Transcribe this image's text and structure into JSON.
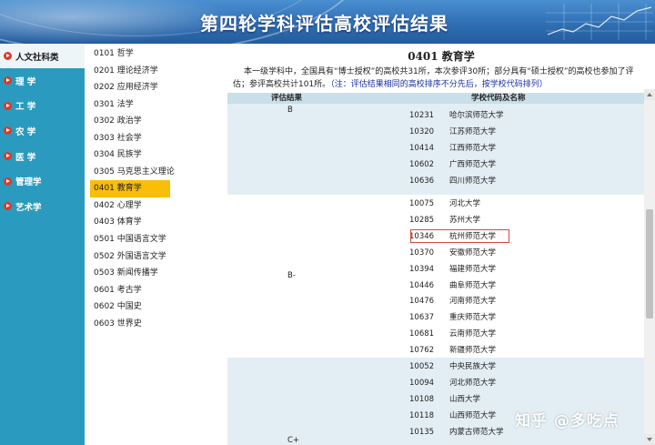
{
  "banner": {
    "title": "第四轮学科评估高校评估结果"
  },
  "left_nav": {
    "items": [
      {
        "label": "人文社科类",
        "active": true
      },
      {
        "label": "理 学",
        "active": false
      },
      {
        "label": "工 学",
        "active": false
      },
      {
        "label": "农 学",
        "active": false
      },
      {
        "label": "医 学",
        "active": false
      },
      {
        "label": "管理学",
        "active": false
      },
      {
        "label": "艺术学",
        "active": false
      }
    ]
  },
  "disciplines": [
    {
      "label": "0101 哲学",
      "selected": false
    },
    {
      "label": "0201 理论经济学",
      "selected": false
    },
    {
      "label": "0202 应用经济学",
      "selected": false
    },
    {
      "label": "0301 法学",
      "selected": false
    },
    {
      "label": "0302 政治学",
      "selected": false
    },
    {
      "label": "0303 社会学",
      "selected": false
    },
    {
      "label": "0304 民族学",
      "selected": false
    },
    {
      "label": "0305 马克思主义理论",
      "selected": false
    },
    {
      "label": "0401 教育学",
      "selected": true
    },
    {
      "label": "0402 心理学",
      "selected": false
    },
    {
      "label": "0403 体育学",
      "selected": false
    },
    {
      "label": "0501 中国语言文学",
      "selected": false
    },
    {
      "label": "0502 外国语言文学",
      "selected": false
    },
    {
      "label": "0503 新闻传播学",
      "selected": false
    },
    {
      "label": "0601 考古学",
      "selected": false
    },
    {
      "label": "0602 中国史",
      "selected": false
    },
    {
      "label": "0603 世界史",
      "selected": false
    }
  ],
  "content": {
    "title": "0401 教育学",
    "description": "本一级学科中，全国具有“博士授权”的高校共31所，本次参评30所；部分具有“硕士授权”的高校也参加了评估；参评高校共计101所。",
    "note": "（注：评估结果相同的高校排序不分先后，按学校代码排列）",
    "table_headers": {
      "grade": "评估结果",
      "school": "学校代码及名称"
    },
    "groups": [
      {
        "grade": "B",
        "rows": [
          {
            "code": "10231",
            "name": "哈尔滨师范大学"
          },
          {
            "code": "10320",
            "name": "江苏师范大学"
          },
          {
            "code": "10414",
            "name": "江西师范大学"
          },
          {
            "code": "10602",
            "name": "广西师范大学"
          },
          {
            "code": "10636",
            "name": "四川师范大学"
          }
        ]
      },
      {
        "grade": "B-",
        "rows": [
          {
            "code": "10075",
            "name": "河北大学"
          },
          {
            "code": "10285",
            "name": "苏州大学"
          },
          {
            "code": "10346",
            "name": "杭州师范大学",
            "highlighted": true
          },
          {
            "code": "10370",
            "name": "安徽师范大学"
          },
          {
            "code": "10394",
            "name": "福建师范大学"
          },
          {
            "code": "10446",
            "name": "曲阜师范大学"
          },
          {
            "code": "10476",
            "name": "河南师范大学"
          },
          {
            "code": "10637",
            "name": "重庆师范大学"
          },
          {
            "code": "10681",
            "name": "云南师范大学"
          },
          {
            "code": "10762",
            "name": "新疆师范大学"
          }
        ]
      },
      {
        "grade": "C+",
        "rows": [
          {
            "code": "10052",
            "name": "中央民族大学"
          },
          {
            "code": "10094",
            "name": "河北师范大学"
          },
          {
            "code": "10108",
            "name": "山西大学"
          },
          {
            "code": "10118",
            "name": "山西师范大学"
          },
          {
            "code": "10135",
            "name": "内蒙古师范大学"
          }
        ]
      }
    ]
  },
  "watermark": "知乎 @多吃点",
  "colors": {
    "nav_bg": "#2a9bbe",
    "selected_discipline": "#f8be09",
    "table_header": "#c9dfe9",
    "group_b_bg": "#e3eef4",
    "group_bminus_bg": "#ffffff",
    "group_cplus_bg": "#e3eef4",
    "highlight_border": "#d9463b",
    "note_text": "#1a2fa0"
  }
}
